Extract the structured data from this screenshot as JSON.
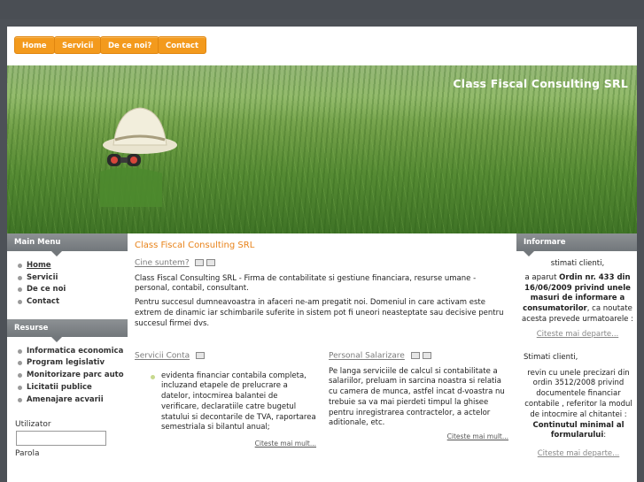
{
  "nav": {
    "items": [
      {
        "label": "Home"
      },
      {
        "label": "Servicii"
      },
      {
        "label": "De ce noi?"
      },
      {
        "label": "Contact"
      }
    ]
  },
  "header": {
    "title": "Class Fiscal Consulting SRL"
  },
  "left": {
    "main_menu": {
      "title": "Main Menu",
      "items": [
        "Home",
        "Servicii",
        "De ce noi",
        "Contact"
      ]
    },
    "resurse": {
      "title": "Resurse",
      "items": [
        "Informatica economica",
        "Program legislativ",
        "Monitorizare parc auto",
        "Licitatii publice",
        "Amenajare acvarii"
      ]
    },
    "login": {
      "username_label": "Utilizator",
      "password_label": "Parola"
    }
  },
  "main": {
    "title": "Class Fiscal Consulting SRL",
    "who": {
      "link": "Cine suntem?",
      "p1": "Class Fiscal Consulting SRL - Firma de contabilitate si gestiune financiara, resurse umane - personal, contabil, consultant.",
      "p2": "Pentru succesul dumneavoastra in afaceri ne-am pregatit noi. Domeniul in care activam este extrem de dinamic iar schimbarile suferite in sistem pot fi uneori neasteptate sau decisive pentru succesul firmei dvs."
    },
    "col1": {
      "link": "Servicii Conta",
      "text": "evidenta financiar contabila completa, incluzand etapele de prelucrare a datelor, intocmirea balantei de verificare, declaratiile catre bugetul statului si decontarile de TVA, raportarea semestriala si bilantul anual;",
      "more": "Citeste mai mult..."
    },
    "col2": {
      "link": "Personal Salarizare",
      "text": "Pe langa serviciile de calcul si contabilitate a salariilor, preluam in sarcina noastra si relatia cu camera de munca, astfel incat d-voastra nu trebuie sa va mai pierdeti timpul la ghisee pentru inregistrarea contractelor, a actelor aditionale, etc.",
      "more": "Citeste mai mult..."
    }
  },
  "right": {
    "title": "Informare",
    "n1": {
      "greeting": "stimati clienti,",
      "pre": "a aparut",
      "bold": "Ordin nr. 433 din 16/06/2009 privind unele masuri de informare a consumatorilor",
      "post": ", ca noutate acesta prevede urmatoarele :",
      "more": "Citeste mai departe..."
    },
    "n2": {
      "greeting": "Stimati clienti,",
      "text": "revin cu unele precizari din ordin 3512/2008 privind documentele financiar contabile , referitor la modul de intocmire al chitantei :",
      "bold": "Continutul minimal al formularului",
      "colon": ":",
      "more": "Citeste mai departe..."
    }
  }
}
